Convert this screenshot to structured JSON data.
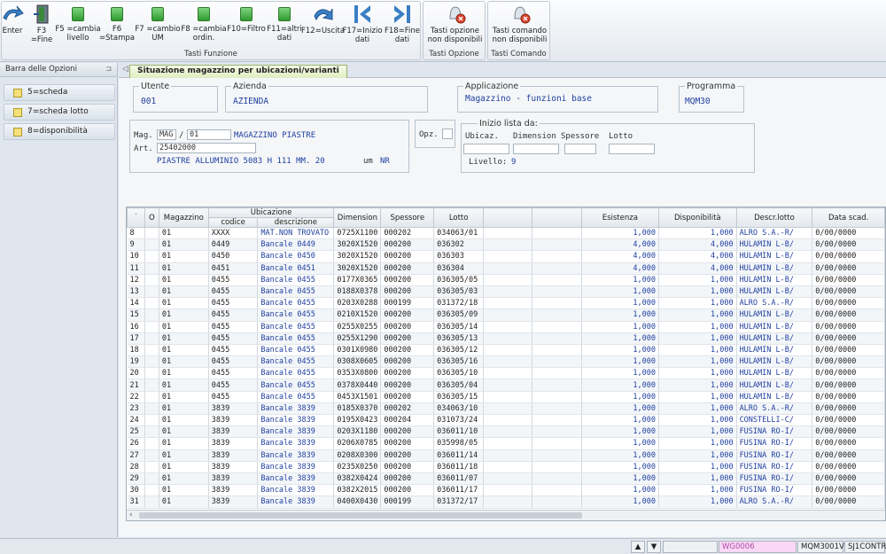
{
  "toolbar": {
    "function_keys": [
      {
        "label": "Enter",
        "icon": "enter-arrow-icon"
      },
      {
        "label": "F3\n=Fine",
        "icon": "door-exit-icon"
      },
      {
        "label": "F5  =cambia\nlivello",
        "icon": "green-square-icon"
      },
      {
        "label": "F6\n=Stampa",
        "icon": "green-square-icon"
      },
      {
        "label": "F7  =cambio\nUM",
        "icon": "green-square-icon"
      },
      {
        "label": "F8  =cambia\nordin.",
        "icon": "green-square-icon"
      },
      {
        "label": "F10=Filtro",
        "icon": "green-square-icon"
      },
      {
        "label": "F11=altri\ndati",
        "icon": "green-square-icon"
      },
      {
        "label": "F12=Uscita",
        "icon": "back-arrow-icon"
      },
      {
        "label": "F17=Inizio\ndati",
        "icon": "first-page-icon"
      },
      {
        "label": "F18=Fine\ndati",
        "icon": "last-page-icon"
      }
    ],
    "group_funzione_label": "Tasti Funzione",
    "opzione_button": "Tasti opzione\nnon disponibili",
    "group_opzione_label": "Tasti Opzione",
    "comando_button": "Tasti comando\nnon disponibili",
    "group_comando_label": "Tasti Comando"
  },
  "left_panel": {
    "title": "Barra delle Opzioni",
    "options": [
      "5=scheda",
      "7=scheda lotto",
      "8=disponibilità"
    ]
  },
  "tab": {
    "title": "Situazione magazzino per ubicazioni/varianti"
  },
  "header": {
    "utente_label": "Utente",
    "utente_value": "001",
    "azienda_label": "Azienda",
    "azienda_value": "AZIENDA",
    "applicazione_label": "Applicazione",
    "applicazione_value": "Magazzino - funzioni base",
    "programma_label": "Programma",
    "programma_value": "MQM30"
  },
  "filters": {
    "mag_label": "Mag.",
    "mag_value": "MAG",
    "mag_sep": "/",
    "mag_code": "01",
    "mag_desc": "MAGAZZINO PIASTRE",
    "art_label": "Art.",
    "art_value": "25402000",
    "art_desc": "PIASTRE ALLUMINIO 5083 H 111 MM. 20",
    "um_label": "um",
    "um_value": "NR",
    "opz_label": "Opz.",
    "inizio_label": "Inizio lista da:",
    "ubicaz_label": "Ubicaz.",
    "dimension_label": "Dimension",
    "spessore_label": "Spessore",
    "lotto_label": "Lotto",
    "livello_label": "Livello:",
    "livello_value": "9"
  },
  "grid": {
    "headers": {
      "o": "O",
      "magazzino": "Magazzino",
      "ubicazione": "Ubicazione",
      "codice": "codice",
      "descrizione": "descrizione",
      "dimension": "Dimension",
      "spessore": "Spessore",
      "lotto": "Lotto",
      "esistenza": "Esistenza",
      "disponibilita": "Disponibilità",
      "descr_lotto": "Descr.lotto",
      "data_scad": "Data scad."
    },
    "rows": [
      [
        "8",
        "01",
        "XXXX",
        "MAT.NON TROVATO",
        "0725X1100",
        "000202",
        "034063/01",
        "1,000",
        "1,000",
        "ALRO S.A.-R/",
        "0/00/0000"
      ],
      [
        "9",
        "01",
        "0449",
        "Bancale 0449",
        "3020X1520",
        "000200",
        "036302",
        "4,000",
        "4,000",
        "HULAMIN L-B/",
        "0/00/0000"
      ],
      [
        "10",
        "01",
        "0450",
        "Bancale 0450",
        "3020X1520",
        "000200",
        "036303",
        "4,000",
        "4,000",
        "HULAMIN L-B/",
        "0/00/0000"
      ],
      [
        "11",
        "01",
        "0451",
        "Bancale 0451",
        "3020X1520",
        "000200",
        "036304",
        "4,000",
        "4,000",
        "HULAMIN L-B/",
        "0/00/0000"
      ],
      [
        "12",
        "01",
        "0455",
        "Bancale 0455",
        "0177X0365",
        "000200",
        "036305/05",
        "1,000",
        "1,000",
        "HULAMIN L-B/",
        "0/00/0000"
      ],
      [
        "13",
        "01",
        "0455",
        "Bancale 0455",
        "0188X0378",
        "000200",
        "036305/03",
        "1,000",
        "1,000",
        "HULAMIN L-B/",
        "0/00/0000"
      ],
      [
        "14",
        "01",
        "0455",
        "Bancale 0455",
        "0203X0288",
        "000199",
        "031372/18",
        "1,000",
        "1,000",
        "ALRO S.A.-R/",
        "0/00/0000"
      ],
      [
        "15",
        "01",
        "0455",
        "Bancale 0455",
        "0210X1520",
        "000200",
        "036305/09",
        "1,000",
        "1,000",
        "HULAMIN L-B/",
        "0/00/0000"
      ],
      [
        "16",
        "01",
        "0455",
        "Bancale 0455",
        "0255X0255",
        "000200",
        "036305/14",
        "1,000",
        "1,000",
        "HULAMIN L-B/",
        "0/00/0000"
      ],
      [
        "17",
        "01",
        "0455",
        "Bancale 0455",
        "0255X1290",
        "000200",
        "036305/13",
        "1,000",
        "1,000",
        "HULAMIN L-B/",
        "0/00/0000"
      ],
      [
        "18",
        "01",
        "0455",
        "Bancale 0455",
        "0301X0980",
        "000200",
        "036305/12",
        "1,000",
        "1,000",
        "HULAMIN L-B/",
        "0/00/0000"
      ],
      [
        "19",
        "01",
        "0455",
        "Bancale 0455",
        "0308X0605",
        "000200",
        "036305/16",
        "1,000",
        "1,000",
        "HULAMIN L-B/",
        "0/00/0000"
      ],
      [
        "20",
        "01",
        "0455",
        "Bancale 0455",
        "0353X0800",
        "000200",
        "036305/10",
        "1,000",
        "1,000",
        "HULAMIN L-B/",
        "0/00/0000"
      ],
      [
        "21",
        "01",
        "0455",
        "Bancale 0455",
        "0378X0440",
        "000200",
        "036305/04",
        "1,000",
        "1,000",
        "HULAMIN L-B/",
        "0/00/0000"
      ],
      [
        "22",
        "01",
        "0455",
        "Bancale 0455",
        "0453X1501",
        "000200",
        "036305/15",
        "1,000",
        "1,000",
        "HULAMIN L-B/",
        "0/00/0000"
      ],
      [
        "23",
        "01",
        "3839",
        "Bancale 3839",
        "0185X0370",
        "000202",
        "034063/10",
        "1,000",
        "1,000",
        "ALRO S.A.-R/",
        "0/00/0000"
      ],
      [
        "24",
        "01",
        "3839",
        "Bancale 3839",
        "0195X0423",
        "000204",
        "031073/24",
        "1,000",
        "1,000",
        "CONSTELLI-C/",
        "0/00/0000"
      ],
      [
        "25",
        "01",
        "3839",
        "Bancale 3839",
        "0203X1180",
        "000200",
        "036011/10",
        "1,000",
        "1,000",
        "FUSINA RO-I/",
        "0/00/0000"
      ],
      [
        "26",
        "01",
        "3839",
        "Bancale 3839",
        "0206X0785",
        "000200",
        "035998/05",
        "1,000",
        "1,000",
        "FUSINA RO-I/",
        "0/00/0000"
      ],
      [
        "27",
        "01",
        "3839",
        "Bancale 3839",
        "0208X0300",
        "000200",
        "036011/14",
        "1,000",
        "1,000",
        "FUSINA RO-I/",
        "0/00/0000"
      ],
      [
        "28",
        "01",
        "3839",
        "Bancale 3839",
        "0235X0250",
        "000200",
        "036011/18",
        "1,000",
        "1,000",
        "FUSINA RO-I/",
        "0/00/0000"
      ],
      [
        "29",
        "01",
        "3839",
        "Bancale 3839",
        "0382X0424",
        "000200",
        "036011/07",
        "1,000",
        "1,000",
        "FUSINA RO-I/",
        "0/00/0000"
      ],
      [
        "30",
        "01",
        "3839",
        "Bancale 3839",
        "0382X2015",
        "000200",
        "036011/17",
        "1,000",
        "1,000",
        "FUSINA RO-I/",
        "0/00/0000"
      ],
      [
        "31",
        "01",
        "3839",
        "Bancale 3839",
        "0400X0430",
        "000199",
        "031372/17",
        "1,000",
        "1,000",
        "ALRO S.A.-R/",
        "0/00/0000"
      ]
    ]
  },
  "statusbar": {
    "session": "WG0006",
    "program": "MQM3001V",
    "job": "SJ1CONTR"
  },
  "colors": {
    "value_blue": "#1f3fa0",
    "green_key": "#2f9a2f",
    "session_pink": "#f8d8f4"
  }
}
